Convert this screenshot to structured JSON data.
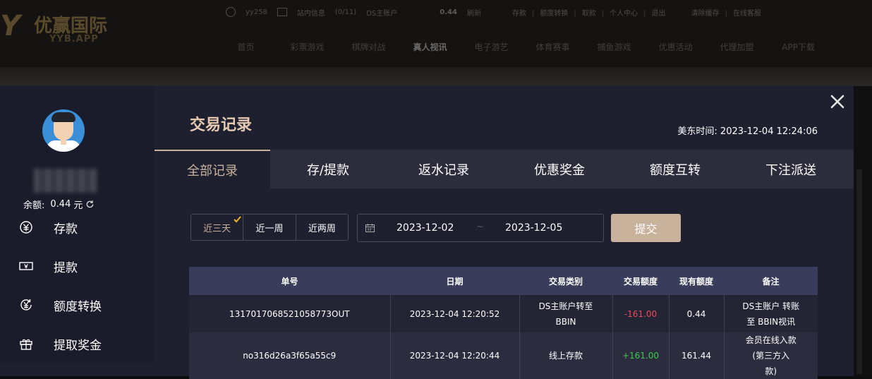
{
  "site": {
    "logo_cn": "优赢国际",
    "logo_en": "YYB.APP",
    "topbar": {
      "username": "yy258",
      "message": "站内信息",
      "message_count": "(0/11)",
      "account": "DS主账户",
      "balance": "0.44",
      "refresh": "刷新",
      "links": [
        "存款",
        "额度转换",
        "取款",
        "个人中心",
        "退出"
      ],
      "extra": [
        "清除缓存",
        "在线客服"
      ]
    },
    "nav": [
      "首页",
      "彩票游戏",
      "棋牌对战",
      "真人视讯",
      "电子游艺",
      "体育赛事",
      "捕鱼游戏",
      "优惠活动",
      "代理加盟",
      "APP下载"
    ],
    "nav_active": 3
  },
  "sidebar": {
    "balance_label": "余额:",
    "balance_value": "0.44",
    "balance_unit": "元",
    "items": [
      {
        "label": "存款",
        "icon": "yuan-coin-icon"
      },
      {
        "label": "提款",
        "icon": "banknote-icon"
      },
      {
        "label": "额度转换",
        "icon": "yuan-exchange-icon"
      },
      {
        "label": "提取奖金",
        "icon": "gift-icon"
      }
    ]
  },
  "modal": {
    "title": "交易记录",
    "time_label": "美东时间:",
    "time_value": "2023-12-04 12:24:06",
    "tabs": [
      "全部记录",
      "存/提款",
      "返水记录",
      "优惠奖金",
      "额度互转",
      "下注派送"
    ],
    "active_tab": 0
  },
  "filter": {
    "ranges": [
      "近三天",
      "近一周",
      "近两周"
    ],
    "active_range": 0,
    "date_start": "2023-12-02",
    "date_sep": "~",
    "date_end": "2023-12-05",
    "submit": "提交"
  },
  "table": {
    "headers": [
      "单号",
      "日期",
      "交易类别",
      "交易额度",
      "现有额度",
      "备注"
    ],
    "rows": [
      {
        "id": "1317017068521058773OUT",
        "date": "2023-12-04 12:20:52",
        "type": [
          "DS主账户转至",
          "BBIN"
        ],
        "amount": "-161.00",
        "amount_sign": "neg",
        "balance": "0.44",
        "remark": [
          "DS主账户 转账",
          "至 BBIN视讯"
        ]
      },
      {
        "id": "no316d26a3f65a55c9",
        "date": "2023-12-04 12:20:44",
        "type": [
          "线上存款"
        ],
        "amount": "+161.00",
        "amount_sign": "pos",
        "balance": "161.44",
        "remark": [
          "会员在线入款",
          "(第三方入",
          "款)"
        ]
      }
    ]
  },
  "colors": {
    "accent": "#c9b29c",
    "title": "#e5c9b0",
    "negative": "#ec4a5c",
    "positive": "#3fc84f",
    "table_header": "#393c5a"
  }
}
